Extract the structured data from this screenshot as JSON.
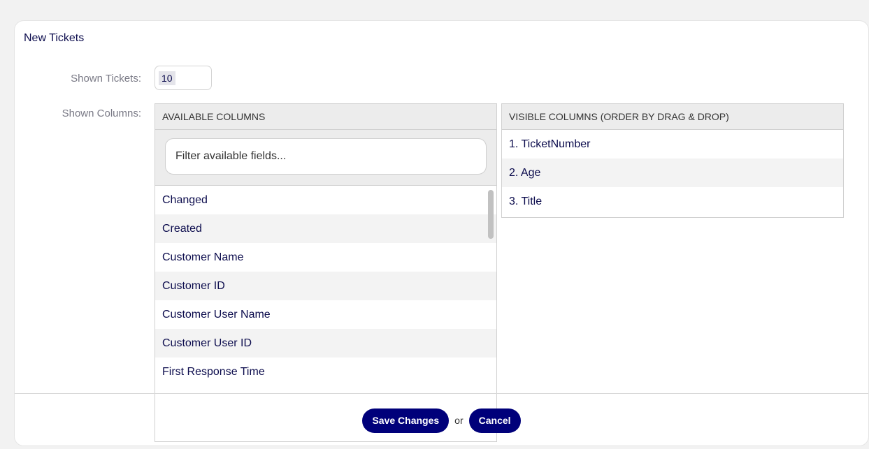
{
  "widget": {
    "title": "New Tickets",
    "shown_tickets_label": "Shown Tickets:",
    "shown_tickets_value": "10",
    "shown_columns_label": "Shown Columns:"
  },
  "available": {
    "header": "AVAILABLE COLUMNS",
    "filter_placeholder": "Filter available fields...",
    "items": [
      "Changed",
      "Created",
      "Customer Name",
      "Customer ID",
      "Customer User Name",
      "Customer User ID",
      "First Response Time"
    ]
  },
  "visible": {
    "header": "VISIBLE COLUMNS (ORDER BY DRAG & DROP)",
    "items": [
      "1. TicketNumber",
      "2. Age",
      "3. Title"
    ]
  },
  "footer": {
    "save_label": "Save Changes",
    "or_label": "or",
    "cancel_label": "Cancel"
  }
}
